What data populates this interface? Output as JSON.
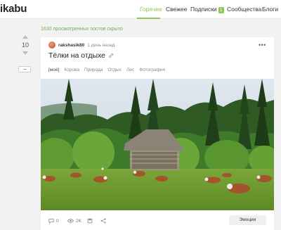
{
  "header": {
    "logo": "ikabu",
    "nav": [
      {
        "label": "Горячее",
        "active": true
      },
      {
        "label": "Свежее",
        "active": false
      },
      {
        "label": "Подписки",
        "badge": "1",
        "active": false
      },
      {
        "label": "Сообщества",
        "active": false
      },
      {
        "label": "Блоги",
        "active": false
      }
    ]
  },
  "feed": {
    "hidden_posts_text": "1630 просмотренных постов скрыто"
  },
  "post": {
    "rating": "10",
    "author": "rakshasik80",
    "time": "1 день назад",
    "title": "Тёлки на отдыхе",
    "tags": [
      "[моё]",
      "Корова",
      "Природа",
      "Отдых",
      "Лес",
      "Фотография"
    ],
    "footer": {
      "comments": "0",
      "views": "2K",
      "emotions_label": "Эмоции"
    }
  },
  "colors": {
    "accent": "#8ac858",
    "hidden_text": "#7aab4f"
  },
  "icons": {
    "comments": "comment-icon",
    "views": "eye-icon",
    "save": "bookmark-icon",
    "share": "share-icon",
    "more": "more-dots-icon",
    "link": "link-icon"
  }
}
